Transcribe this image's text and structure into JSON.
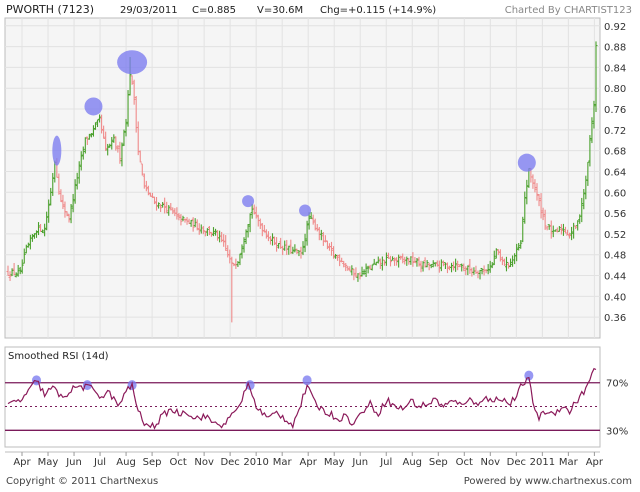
{
  "header": {
    "symbol": "PWORTH (7123)",
    "date": "29/03/2011",
    "close": "C=0.885",
    "volume": "V=30.6M",
    "change": "Chg=+0.115 (+14.9%)",
    "charted_by": "Charted By CHARTIST123"
  },
  "footer": {
    "copyright": "Copyright © 2011 ChartNexus",
    "powered_by": "Powered by www.chartnexus.com"
  },
  "colors": {
    "background": "#ffffff",
    "plot_bg": "#f5f5f5",
    "grid": "#e2e2e2",
    "up_bar": "#4aa02c",
    "down_bar": "#ef8a8a",
    "rsi_line": "#8b1a5a",
    "rsi_band": "#7a1a5a",
    "highlight": "#7b7bef",
    "text": "#333333",
    "header_text": "#222222"
  },
  "chart_data": [
    {
      "type": "ohlc",
      "panel": "price",
      "x_axis": {
        "ticks": [
          "Apr",
          "May",
          "Jun",
          "Jul",
          "Aug",
          "Sep",
          "Oct",
          "Nov",
          "Dec",
          "2010",
          "Mar",
          "Apr",
          "May",
          "Jun",
          "Jul",
          "Aug",
          "Sep",
          "Oct",
          "Nov",
          "Dec",
          "2011",
          "Mar",
          "Apr"
        ]
      },
      "y_axis": {
        "ticks": [
          0.36,
          0.4,
          0.44,
          0.48,
          0.52,
          0.56,
          0.6,
          0.64,
          0.68,
          0.72,
          0.76,
          0.8,
          0.84,
          0.88,
          0.92
        ],
        "ylim": [
          0.32,
          0.935
        ],
        "side": "right"
      },
      "grid": true,
      "anchors": [
        {
          "i": 0,
          "c": 0.445
        },
        {
          "i": 6,
          "c": 0.445
        },
        {
          "i": 9,
          "c": 0.49
        },
        {
          "i": 14,
          "c": 0.53
        },
        {
          "i": 18,
          "c": 0.53
        },
        {
          "i": 21,
          "c": 0.6
        },
        {
          "i": 23,
          "c": 0.66
        },
        {
          "i": 26,
          "c": 0.58
        },
        {
          "i": 30,
          "c": 0.55
        },
        {
          "i": 34,
          "c": 0.63
        },
        {
          "i": 38,
          "c": 0.7
        },
        {
          "i": 42,
          "c": 0.72
        },
        {
          "i": 45,
          "c": 0.74
        },
        {
          "i": 48,
          "c": 0.68
        },
        {
          "i": 52,
          "c": 0.7
        },
        {
          "i": 55,
          "c": 0.67
        },
        {
          "i": 58,
          "c": 0.74
        },
        {
          "i": 60,
          "c": 0.83
        },
        {
          "i": 62,
          "c": 0.78
        },
        {
          "i": 64,
          "c": 0.68
        },
        {
          "i": 67,
          "c": 0.61
        },
        {
          "i": 72,
          "c": 0.58
        },
        {
          "i": 78,
          "c": 0.57
        },
        {
          "i": 84,
          "c": 0.55
        },
        {
          "i": 90,
          "c": 0.54
        },
        {
          "i": 96,
          "c": 0.53
        },
        {
          "i": 102,
          "c": 0.52
        },
        {
          "i": 106,
          "c": 0.5
        },
        {
          "i": 110,
          "c": 0.46
        },
        {
          "i": 113,
          "c": 0.47
        },
        {
          "i": 117,
          "c": 0.53
        },
        {
          "i": 120,
          "c": 0.57
        },
        {
          "i": 122,
          "c": 0.55
        },
        {
          "i": 127,
          "c": 0.52
        },
        {
          "i": 132,
          "c": 0.5
        },
        {
          "i": 138,
          "c": 0.49
        },
        {
          "i": 144,
          "c": 0.48
        },
        {
          "i": 148,
          "c": 0.55
        },
        {
          "i": 152,
          "c": 0.53
        },
        {
          "i": 156,
          "c": 0.5
        },
        {
          "i": 160,
          "c": 0.48
        },
        {
          "i": 164,
          "c": 0.47
        },
        {
          "i": 168,
          "c": 0.45
        },
        {
          "i": 172,
          "c": 0.44
        },
        {
          "i": 176,
          "c": 0.45
        },
        {
          "i": 180,
          "c": 0.46
        },
        {
          "i": 186,
          "c": 0.47
        },
        {
          "i": 192,
          "c": 0.47
        },
        {
          "i": 198,
          "c": 0.47
        },
        {
          "i": 204,
          "c": 0.46
        },
        {
          "i": 210,
          "c": 0.46
        },
        {
          "i": 216,
          "c": 0.46
        },
        {
          "i": 222,
          "c": 0.46
        },
        {
          "i": 228,
          "c": 0.45
        },
        {
          "i": 234,
          "c": 0.45
        },
        {
          "i": 238,
          "c": 0.46
        },
        {
          "i": 240,
          "c": 0.49
        },
        {
          "i": 242,
          "c": 0.47
        },
        {
          "i": 245,
          "c": 0.46
        },
        {
          "i": 248,
          "c": 0.47
        },
        {
          "i": 252,
          "c": 0.5
        },
        {
          "i": 254,
          "c": 0.59
        },
        {
          "i": 256,
          "c": 0.64
        },
        {
          "i": 258,
          "c": 0.62
        },
        {
          "i": 261,
          "c": 0.58
        },
        {
          "i": 264,
          "c": 0.54
        },
        {
          "i": 268,
          "c": 0.52
        },
        {
          "i": 272,
          "c": 0.53
        },
        {
          "i": 276,
          "c": 0.52
        },
        {
          "i": 280,
          "c": 0.54
        },
        {
          "i": 282,
          "c": 0.58
        },
        {
          "i": 284,
          "c": 0.62
        },
        {
          "i": 286,
          "c": 0.7
        },
        {
          "i": 288,
          "c": 0.77
        },
        {
          "i": 289,
          "c": 0.885
        }
      ],
      "spikes": [
        {
          "i": 110,
          "low": 0.35
        },
        {
          "i": 60,
          "high": 0.86
        },
        {
          "i": 289,
          "high": 0.89
        }
      ],
      "highlights": [
        {
          "i": 24,
          "c": 0.68,
          "shape": "tall"
        },
        {
          "i": 42,
          "c": 0.765,
          "shape": "round"
        },
        {
          "i": 61,
          "c": 0.85,
          "shape": "wide"
        },
        {
          "i": 118,
          "c": 0.583,
          "shape": "small"
        },
        {
          "i": 146,
          "c": 0.565,
          "shape": "small"
        },
        {
          "i": 255,
          "c": 0.657,
          "shape": "round"
        }
      ]
    },
    {
      "type": "line",
      "panel": "indicator",
      "title": "Smoothed RSI (14d)",
      "y_axis": {
        "ticks": [
          "70%",
          "30%"
        ],
        "ylim": [
          16,
          100
        ],
        "side": "right"
      },
      "bands": [
        70,
        50,
        30
      ],
      "anchors": [
        {
          "i": 0,
          "v": 52
        },
        {
          "i": 6,
          "v": 55
        },
        {
          "i": 10,
          "v": 62
        },
        {
          "i": 14,
          "v": 72
        },
        {
          "i": 18,
          "v": 60
        },
        {
          "i": 22,
          "v": 66
        },
        {
          "i": 26,
          "v": 58
        },
        {
          "i": 30,
          "v": 62
        },
        {
          "i": 34,
          "v": 67
        },
        {
          "i": 38,
          "v": 66
        },
        {
          "i": 42,
          "v": 65
        },
        {
          "i": 46,
          "v": 58
        },
        {
          "i": 50,
          "v": 62
        },
        {
          "i": 54,
          "v": 50
        },
        {
          "i": 58,
          "v": 62
        },
        {
          "i": 61,
          "v": 68
        },
        {
          "i": 64,
          "v": 46
        },
        {
          "i": 68,
          "v": 33
        },
        {
          "i": 72,
          "v": 34
        },
        {
          "i": 76,
          "v": 42
        },
        {
          "i": 80,
          "v": 48
        },
        {
          "i": 84,
          "v": 44
        },
        {
          "i": 88,
          "v": 46
        },
        {
          "i": 92,
          "v": 40
        },
        {
          "i": 96,
          "v": 42
        },
        {
          "i": 100,
          "v": 38
        },
        {
          "i": 104,
          "v": 34
        },
        {
          "i": 108,
          "v": 38
        },
        {
          "i": 112,
          "v": 46
        },
        {
          "i": 116,
          "v": 60
        },
        {
          "i": 118,
          "v": 70
        },
        {
          "i": 121,
          "v": 54
        },
        {
          "i": 124,
          "v": 46
        },
        {
          "i": 128,
          "v": 40
        },
        {
          "i": 132,
          "v": 45
        },
        {
          "i": 136,
          "v": 40
        },
        {
          "i": 140,
          "v": 35
        },
        {
          "i": 144,
          "v": 52
        },
        {
          "i": 147,
          "v": 68
        },
        {
          "i": 150,
          "v": 55
        },
        {
          "i": 154,
          "v": 48
        },
        {
          "i": 158,
          "v": 44
        },
        {
          "i": 162,
          "v": 40
        },
        {
          "i": 166,
          "v": 42
        },
        {
          "i": 170,
          "v": 35
        },
        {
          "i": 174,
          "v": 46
        },
        {
          "i": 178,
          "v": 52
        },
        {
          "i": 182,
          "v": 44
        },
        {
          "i": 186,
          "v": 56
        },
        {
          "i": 190,
          "v": 50
        },
        {
          "i": 194,
          "v": 48
        },
        {
          "i": 198,
          "v": 55
        },
        {
          "i": 202,
          "v": 50
        },
        {
          "i": 206,
          "v": 52
        },
        {
          "i": 210,
          "v": 56
        },
        {
          "i": 214,
          "v": 50
        },
        {
          "i": 218,
          "v": 54
        },
        {
          "i": 222,
          "v": 52
        },
        {
          "i": 226,
          "v": 56
        },
        {
          "i": 230,
          "v": 52
        },
        {
          "i": 234,
          "v": 58
        },
        {
          "i": 238,
          "v": 54
        },
        {
          "i": 242,
          "v": 58
        },
        {
          "i": 246,
          "v": 52
        },
        {
          "i": 250,
          "v": 58
        },
        {
          "i": 253,
          "v": 70
        },
        {
          "i": 256,
          "v": 72
        },
        {
          "i": 258,
          "v": 54
        },
        {
          "i": 261,
          "v": 40
        },
        {
          "i": 264,
          "v": 46
        },
        {
          "i": 268,
          "v": 44
        },
        {
          "i": 272,
          "v": 50
        },
        {
          "i": 276,
          "v": 46
        },
        {
          "i": 280,
          "v": 56
        },
        {
          "i": 283,
          "v": 62
        },
        {
          "i": 286,
          "v": 72
        },
        {
          "i": 289,
          "v": 84
        }
      ],
      "highlights": [
        {
          "i": 14,
          "v": 72
        },
        {
          "i": 39,
          "v": 68
        },
        {
          "i": 61,
          "v": 68
        },
        {
          "i": 119,
          "v": 68
        },
        {
          "i": 147,
          "v": 72
        },
        {
          "i": 256,
          "v": 76
        }
      ]
    }
  ]
}
